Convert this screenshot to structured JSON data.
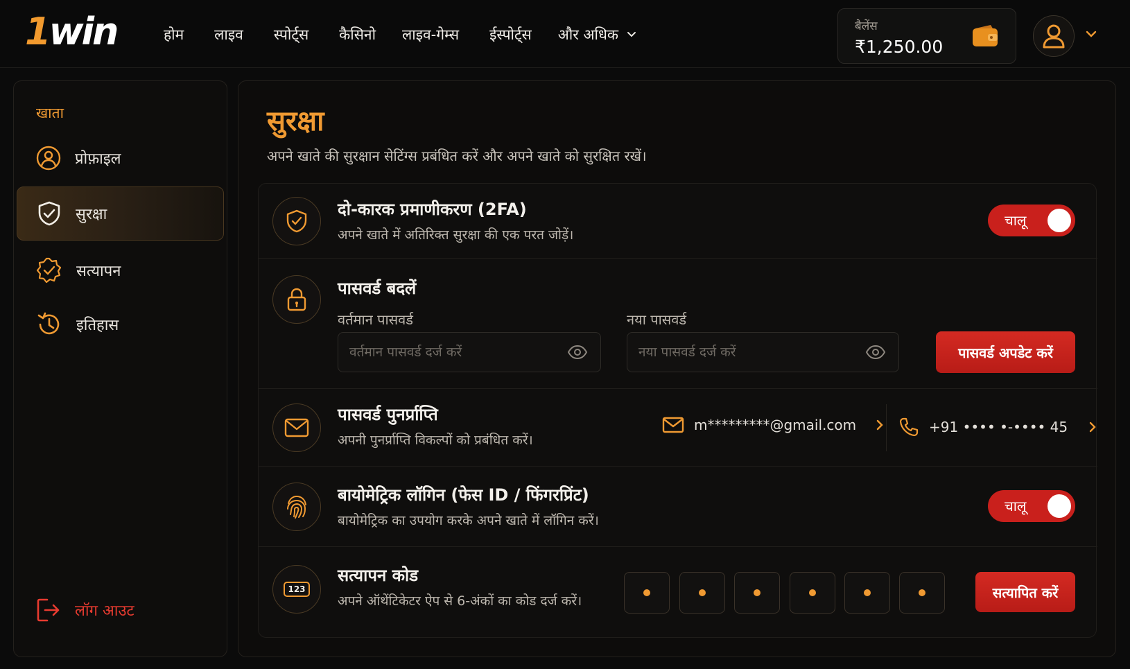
{
  "brand": {
    "logo_one": "1",
    "logo_rest": "win"
  },
  "nav": {
    "items": [
      "होम",
      "लाइव",
      "स्पोर्ट्स",
      "कैसिनो",
      "लाइव-गेम्स",
      "ईस्पोर्ट्स",
      "और अधिक"
    ]
  },
  "balance": {
    "label": "बैलेंस",
    "amount": "₹1,250.00"
  },
  "sidebar": {
    "section_title": "खाता",
    "items": [
      {
        "label": "प्रोफ़ाइल",
        "icon": "user-circle-icon"
      },
      {
        "label": "सुरक्षा",
        "icon": "shield-check-icon",
        "active": true
      },
      {
        "label": "सत्यापन",
        "icon": "badge-check-icon"
      },
      {
        "label": "इतिहास",
        "icon": "history-icon"
      }
    ],
    "logout": "लॉग आउट"
  },
  "page": {
    "title": "सुरक्षा",
    "subtitle": "अपने खाते की सुरक्षान सेटिंग्स प्रबंधित करें और अपने खाते को सुरक्षित रखें।"
  },
  "twofa": {
    "title": "दो-कारक प्रमाणीकरण (2FA)",
    "desc": "अपने खाते में अतिरिक्त सुरक्षा की एक परत जोड़ें।",
    "toggle_label": "चालू",
    "enabled": true
  },
  "password": {
    "title": "पासवर्ड बदलें",
    "current_label": "वर्तमान पासवर्ड",
    "current_placeholder": "वर्तमान पासवर्ड दर्ज करें",
    "new_label": "नया पासवर्ड",
    "new_placeholder": "नया पासवर्ड दर्ज करें",
    "button": "पासवर्ड अपडेट करें"
  },
  "recovery": {
    "title": "पासवर्ड पुनर्प्राप्ति",
    "desc": "अपनी पुनर्प्राप्ति विकल्पों को प्रबंधित करें।",
    "email": "m*********@gmail.com",
    "phone": "+91 •••• •-•••• 45"
  },
  "biometric": {
    "title": "बायोमेट्रिक लॉगिन (फेस ID / फिंगरप्रिंट)",
    "desc": "बायोमेट्रिक का उपयोग करके अपने खाते में लॉगिन करें।",
    "toggle_label": "चालू",
    "enabled": true
  },
  "verify": {
    "title": "सत्यापन कोड",
    "desc": "अपने ऑथेंटिकेटर ऐप से 6-अंकों का कोड दर्ज करें।",
    "icon_text": "123",
    "digits": 6,
    "button": "सत्यापित करें"
  },
  "colors": {
    "accent": "#f09a32",
    "danger": "#c9201c",
    "bg": "#0b0b0b"
  }
}
